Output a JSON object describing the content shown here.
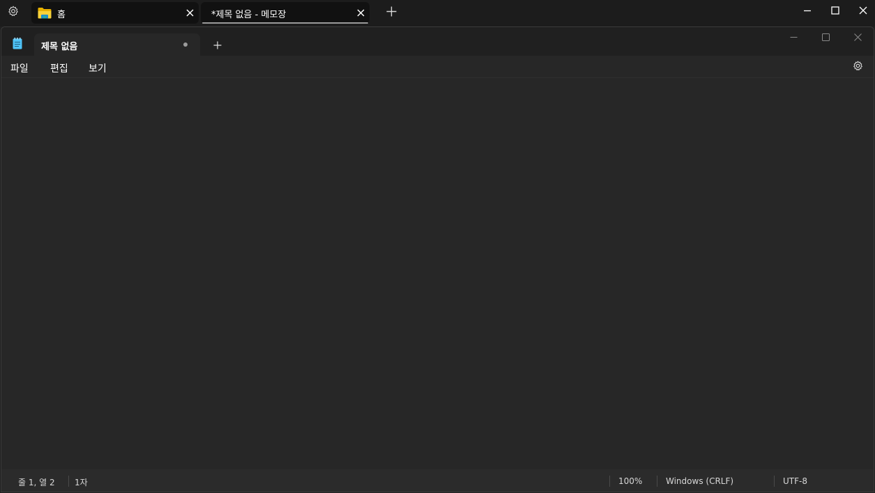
{
  "host": {
    "tabs": [
      {
        "label": "홈",
        "icon": "folder-icon"
      },
      {
        "label": "*제목 없음 - 메모장"
      }
    ],
    "icons": {
      "settings": "gear-icon",
      "new_tab": "plus-icon",
      "close": "close-icon",
      "minimize": "minimize-icon",
      "maximize": "maximize-icon"
    }
  },
  "notepad": {
    "tab_title": "제목 없음",
    "unsaved_indicator": "dot",
    "menu": [
      "파일",
      "편집",
      "보기"
    ],
    "editor_text": "",
    "status": {
      "position": "줄 1, 열 2",
      "characters": "1자",
      "zoom": "100%",
      "line_ending": "Windows (CRLF)",
      "encoding": "UTF-8"
    }
  },
  "colors": {
    "background": "#202020",
    "editor": "#272727",
    "statusbar": "#2b2b2b",
    "folder_yellow": "#f5c518",
    "notepad_icon_blue": "#4fc3f7"
  }
}
